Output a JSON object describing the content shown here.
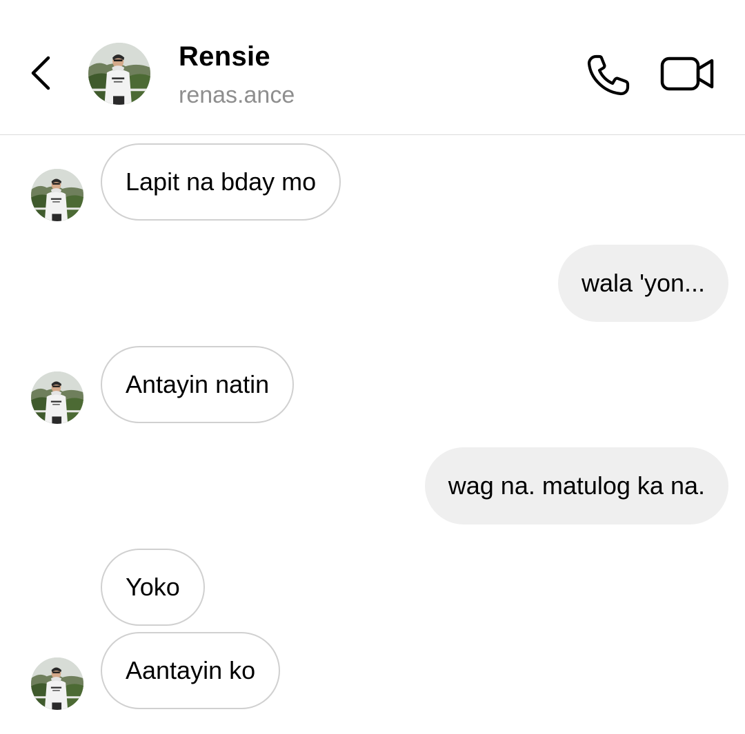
{
  "header": {
    "contact_name": "Rensie",
    "contact_username": "renas.ance",
    "back_icon": "chevron-left-icon",
    "call_icon": "phone-icon",
    "video_icon": "video-camera-icon"
  },
  "messages": [
    {
      "sender": "contact",
      "text": "Lapit na bday mo",
      "show_avatar": true
    },
    {
      "sender": "me",
      "text": "wala 'yon..."
    },
    {
      "sender": "contact",
      "text": "Antayin natin",
      "show_avatar": true
    },
    {
      "sender": "me",
      "text": "wag na. matulog ka na."
    },
    {
      "sender": "contact",
      "text": "Yoko",
      "show_avatar": false
    },
    {
      "sender": "contact",
      "text": "Aantayin ko",
      "show_avatar": true
    }
  ],
  "colors": {
    "incoming_bubble_border": "#d0d0d0",
    "outgoing_bubble_bg": "#efefef",
    "username_gray": "#8e8e8e",
    "divider": "#dbdbdb"
  }
}
